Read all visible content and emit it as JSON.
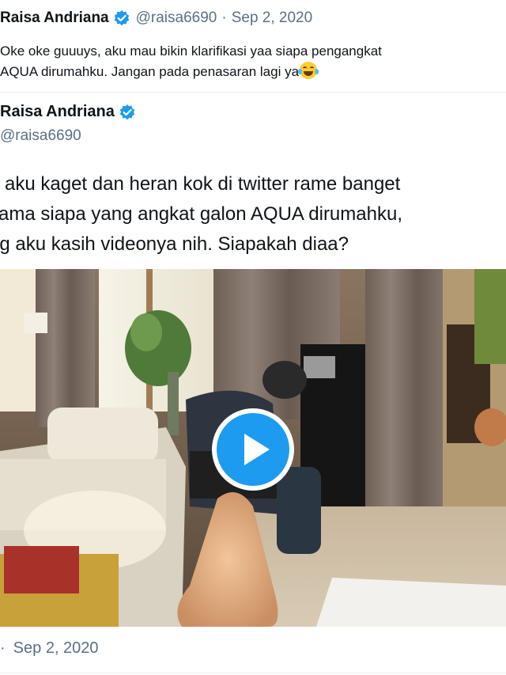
{
  "quoted_tweet": {
    "name": "Raisa Andriana",
    "handle": "@raisa6690",
    "separator": "·",
    "date": "Sep 2, 2020",
    "text_line1": "Oke oke guuuys, aku mau bikin klarifikasi yaa siapa pengangkat",
    "text_line2": "AQUA dirumahku. Jangan pada penasaran lagi ya",
    "emoji": "face-with-tears-of-joy"
  },
  "main_tweet": {
    "name": "Raisa Andriana",
    "handle": "@raisa6690",
    "text_line1": "a aku kaget dan heran kok di twitter rame banget",
    "text_line2": "sama siapa yang angkat galon AQUA dirumahku,",
    "text_line3": "ng aku kasih videonya nih. Siapakah diaa?",
    "separator": "·",
    "date": "Sep 2, 2020"
  },
  "video": {
    "play_icon": "play-icon"
  },
  "colors": {
    "text": "#0f1419",
    "secondary": "#5b7083",
    "accent": "#1d9bf0",
    "divider": "#e6ecf0"
  }
}
